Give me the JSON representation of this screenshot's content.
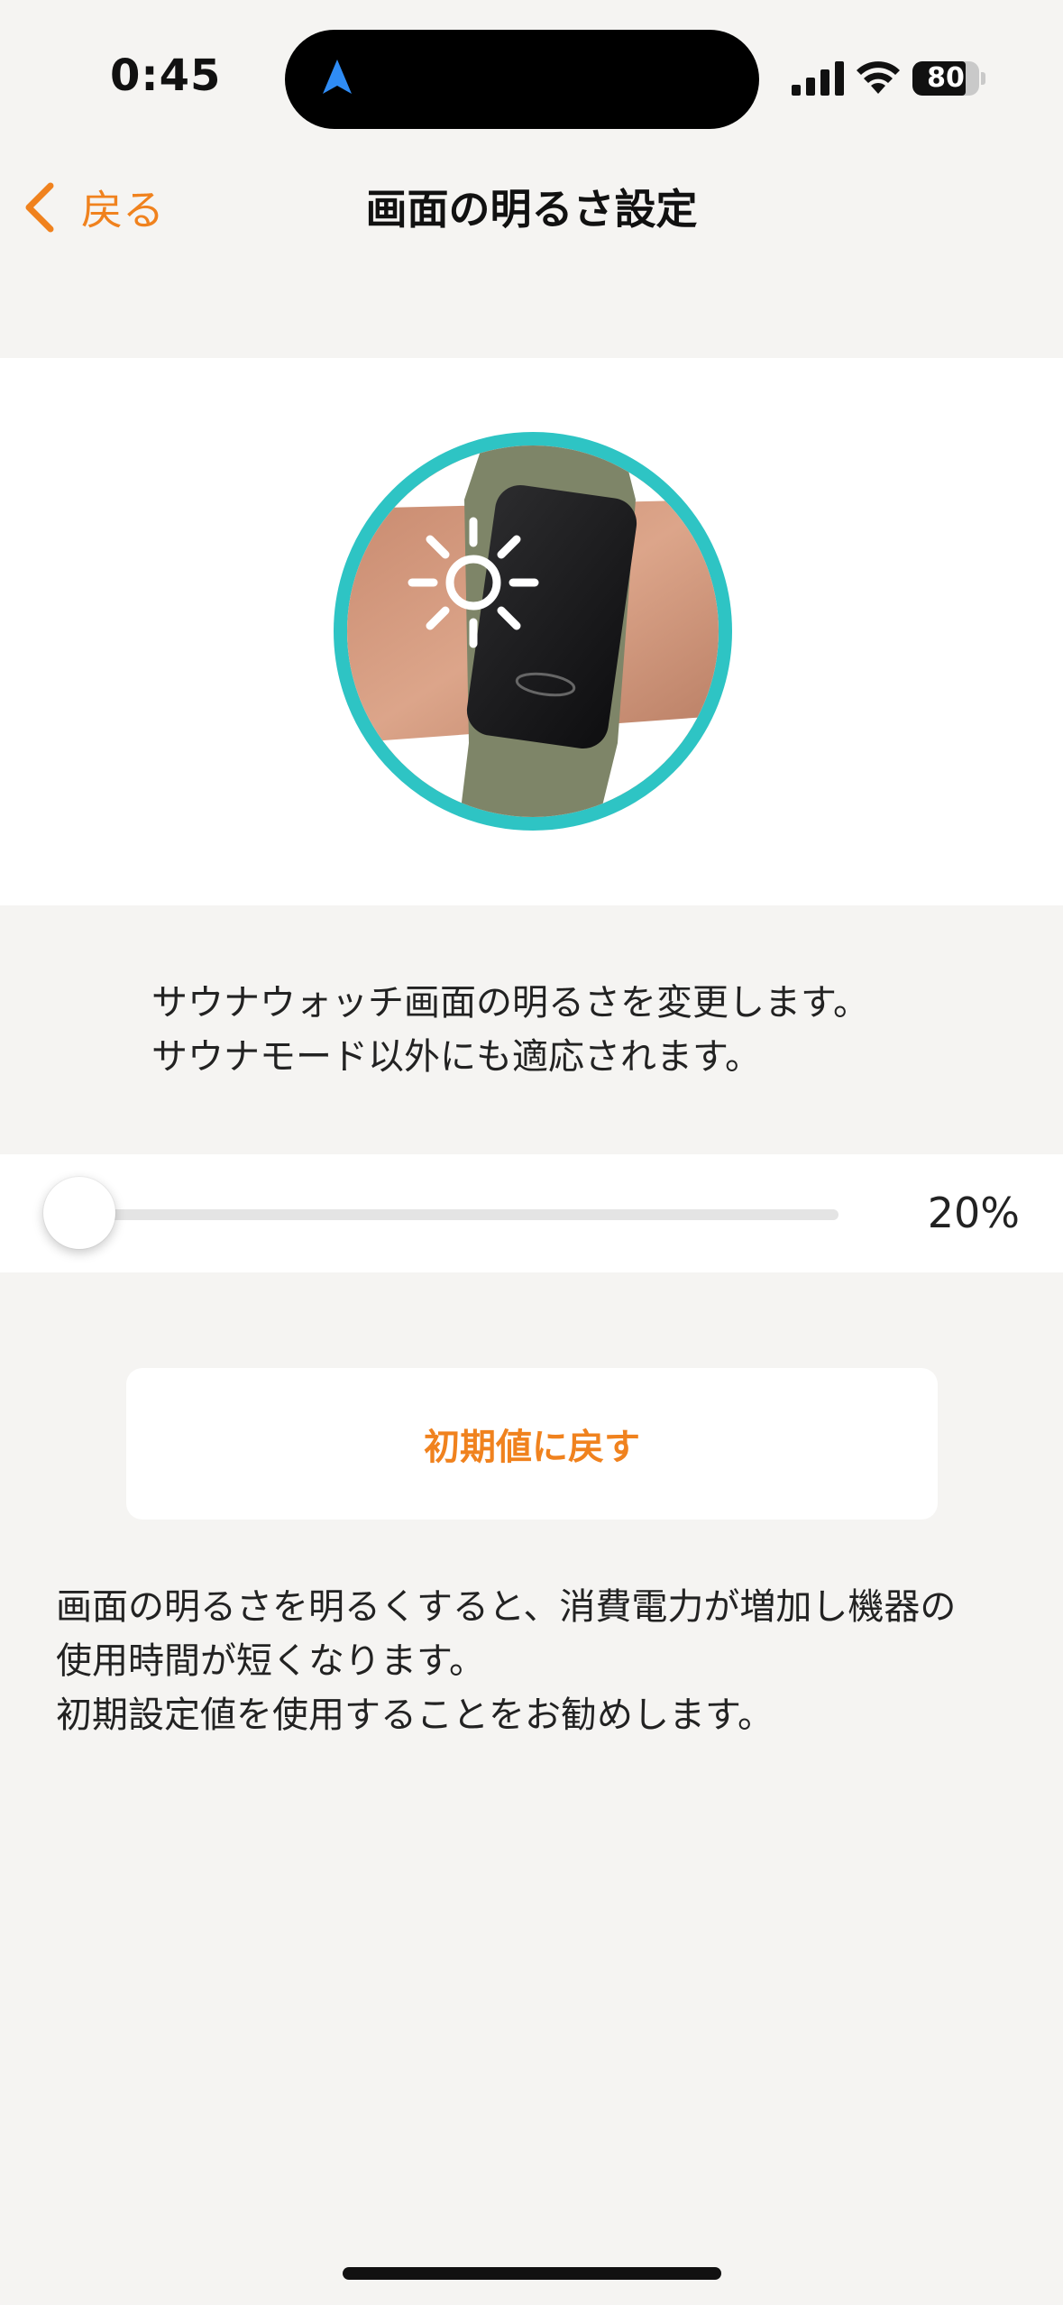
{
  "status_bar": {
    "time": "0:45",
    "battery_percent": "80",
    "battery_level": 0.8
  },
  "navbar": {
    "back_label": "戻る",
    "title": "画面の明るさ設定"
  },
  "description": {
    "line1": "サウナウォッチ画面の明るさを変更します。",
    "line2": "サウナモード以外にも適応されます。"
  },
  "brightness": {
    "value": 20,
    "value_label": "20%"
  },
  "reset_button": {
    "label": "初期値に戻す"
  },
  "note": {
    "line1": "画面の明るさを明るくすると、消費電力が増加し機器の",
    "line2": "使用時間が短くなります。",
    "line3": "初期設定値を使用することをお勧めします。"
  },
  "colors": {
    "accent": "#f0821e",
    "ring": "#2ec4c4",
    "background": "#f5f4f2"
  }
}
